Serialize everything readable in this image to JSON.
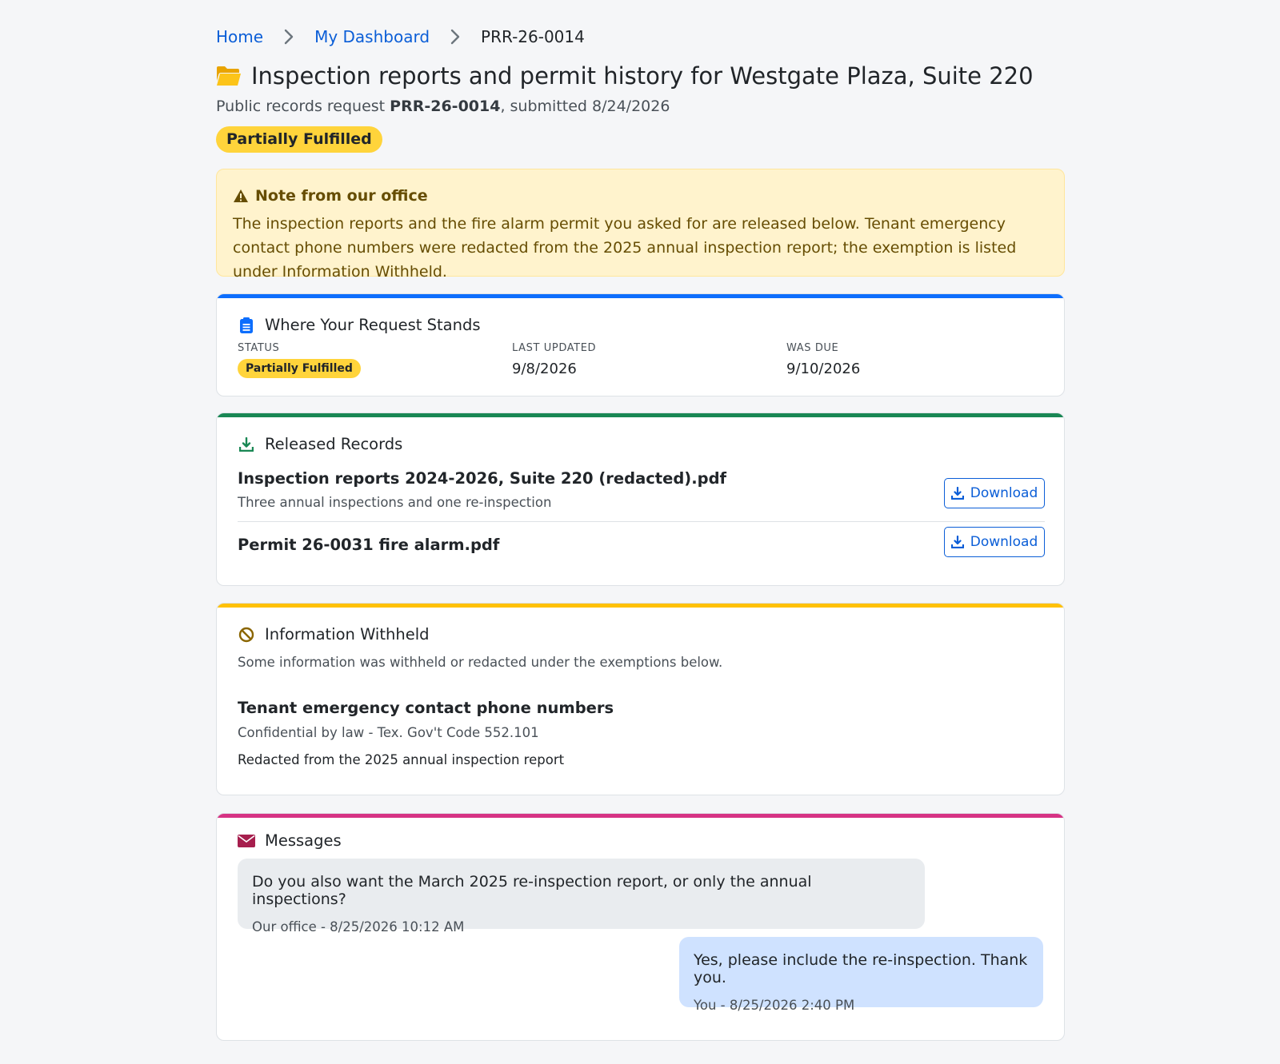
{
  "breadcrumb": {
    "home": "Home",
    "dashboard": "My Dashboard",
    "current": "PRR-26-0014"
  },
  "header": {
    "title": "Inspection reports and permit history for Westgate Plaza, Suite 220",
    "subtitle_prefix": "Public records request ",
    "request_id": "PRR-26-0014",
    "subtitle_suffix": ", submitted 8/24/2026",
    "status": "Partially Fulfilled"
  },
  "alert": {
    "title": "Note from our office",
    "body": "The inspection reports and the fire alarm permit you asked for are released below. Tenant emergency contact phone numbers were redacted from the 2025 annual inspection report; the exemption is listed under Information Withheld."
  },
  "request_status": {
    "heading": "Where Your Request Stands",
    "status_label": "STATUS",
    "status_value": "Partially Fulfilled",
    "updated_label": "LAST UPDATED",
    "updated_value": "9/8/2026",
    "due_label": "WAS DUE",
    "due_value": "9/10/2026"
  },
  "released": {
    "heading": "Released Records",
    "files": [
      {
        "name": "Inspection reports 2024-2026, Suite 220 (redacted).pdf",
        "description": "Three annual inspections and one re-inspection",
        "button": "Download"
      },
      {
        "name": "Permit 26-0031 fire alarm.pdf",
        "button": "Download"
      }
    ]
  },
  "withheld": {
    "heading": "Information Withheld",
    "intro": "Some information was withheld or redacted under the exemptions below.",
    "exemption_title": "Tenant emergency contact phone numbers",
    "exemption_law": "Confidential by law - Tex. Gov't Code 552.101",
    "exemption_note": "Redacted from the 2025 annual inspection report"
  },
  "messages": {
    "heading": "Messages",
    "items": [
      {
        "text": "Do you also want the March 2025 re-inspection report, or only the annual inspections?",
        "meta": "Our office - 8/25/2026 10:12 AM"
      },
      {
        "text": "Yes, please include the re-inspection. Thank you.",
        "meta": "You - 8/25/2026 2:40 PM"
      }
    ]
  },
  "colors": {
    "link": "#0b5ed7",
    "status_yellow": "#ffd43b",
    "bar_status": "#0d6efd",
    "bar_released": "#198754",
    "bar_withheld": "#ffc107",
    "bar_messages": "#d63384"
  },
  "icons": {
    "title": "folder-open-icon",
    "alert": "warning-triangle-icon",
    "status": "clipboard-icon",
    "released": "download-icon",
    "withheld": "ban-icon",
    "messages": "envelope-icon"
  }
}
